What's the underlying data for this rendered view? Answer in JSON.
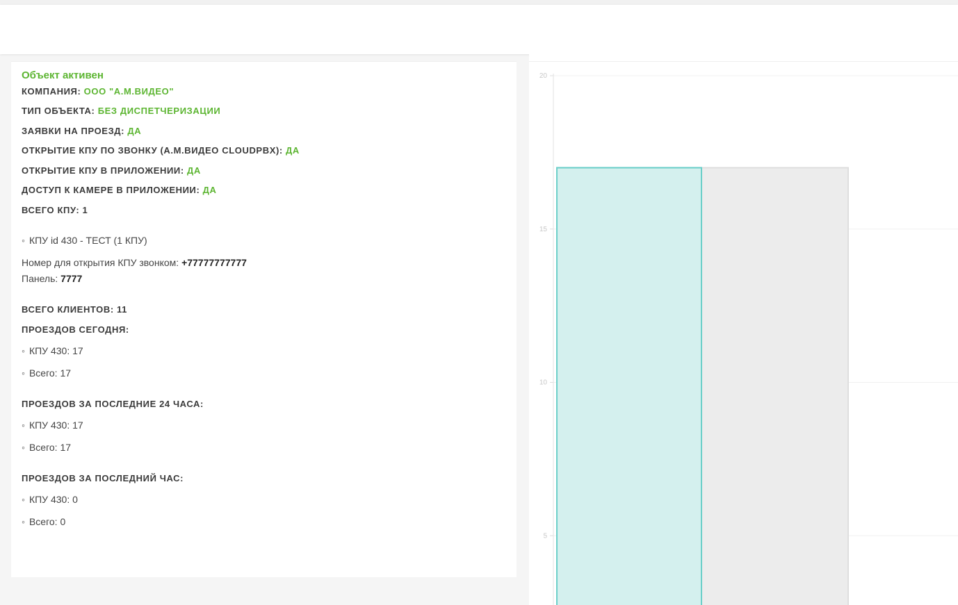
{
  "object": {
    "status": "Объект активен",
    "company": {
      "label": "КОМПАНИЯ:",
      "value": "ООО \"А.М.ВИДЕО\""
    },
    "type": {
      "label": "ТИП ОБЪЕКТА:",
      "value": "БЕЗ ДИСПЕТЧЕРИЗАЦИИ"
    },
    "requests": {
      "label": "ЗАЯВКИ НА ПРОЕЗД:",
      "value": "ДА"
    },
    "call_open": {
      "label": "ОТКРЫТИЕ КПУ ПО ЗВОНКУ (А.М.ВИДЕО CLOUDPBX):",
      "value": "ДА"
    },
    "app_open": {
      "label": "ОТКРЫТИЕ КПУ В ПРИЛОЖЕНИИ:",
      "value": "ДА"
    },
    "camera": {
      "label": "ДОСТУП К КАМЕРЕ В ПРИЛОЖЕНИИ:",
      "value": "ДА"
    },
    "kpu_total": "ВСЕГО КПУ: 1",
    "kpu_item": "КПУ id 430 - ТЕСТ (1 КПУ)",
    "phone": {
      "label": "Номер для открытия КПУ звонком:",
      "value": "+77777777777"
    },
    "panel": {
      "label": "Панель:",
      "value": "7777"
    },
    "clients_total": "ВСЕГО КЛИЕНТОВ: 11",
    "today": {
      "title": "ПРОЕЗДОВ СЕГОДНЯ:",
      "kpu": "КПУ 430: 17",
      "total": "Всего: 17"
    },
    "last24": {
      "title": "ПРОЕЗДОВ ЗА ПОСЛЕДНИЕ 24 ЧАСА:",
      "kpu": "КПУ 430: 17",
      "total": "Всего: 17"
    },
    "last_hour": {
      "title": "ПРОЕЗДОВ ЗА ПОСЛЕДНИЙ ЧАС:",
      "kpu": "КПУ 430: 0",
      "total": "Всего: 0"
    }
  },
  "colors": {
    "accent": "#5cb531",
    "bar_fill": "#d4f0ee",
    "bar_stroke": "#6ccfc9",
    "bar2_fill": "#ececec",
    "bar2_stroke": "#dedede"
  },
  "chart_data": {
    "type": "bar",
    "y_ticks": [
      "20",
      "15",
      "10",
      "5"
    ],
    "ylim": [
      0,
      20
    ],
    "series": [
      {
        "values": [
          17,
          17
        ]
      }
    ],
    "grid": true
  }
}
